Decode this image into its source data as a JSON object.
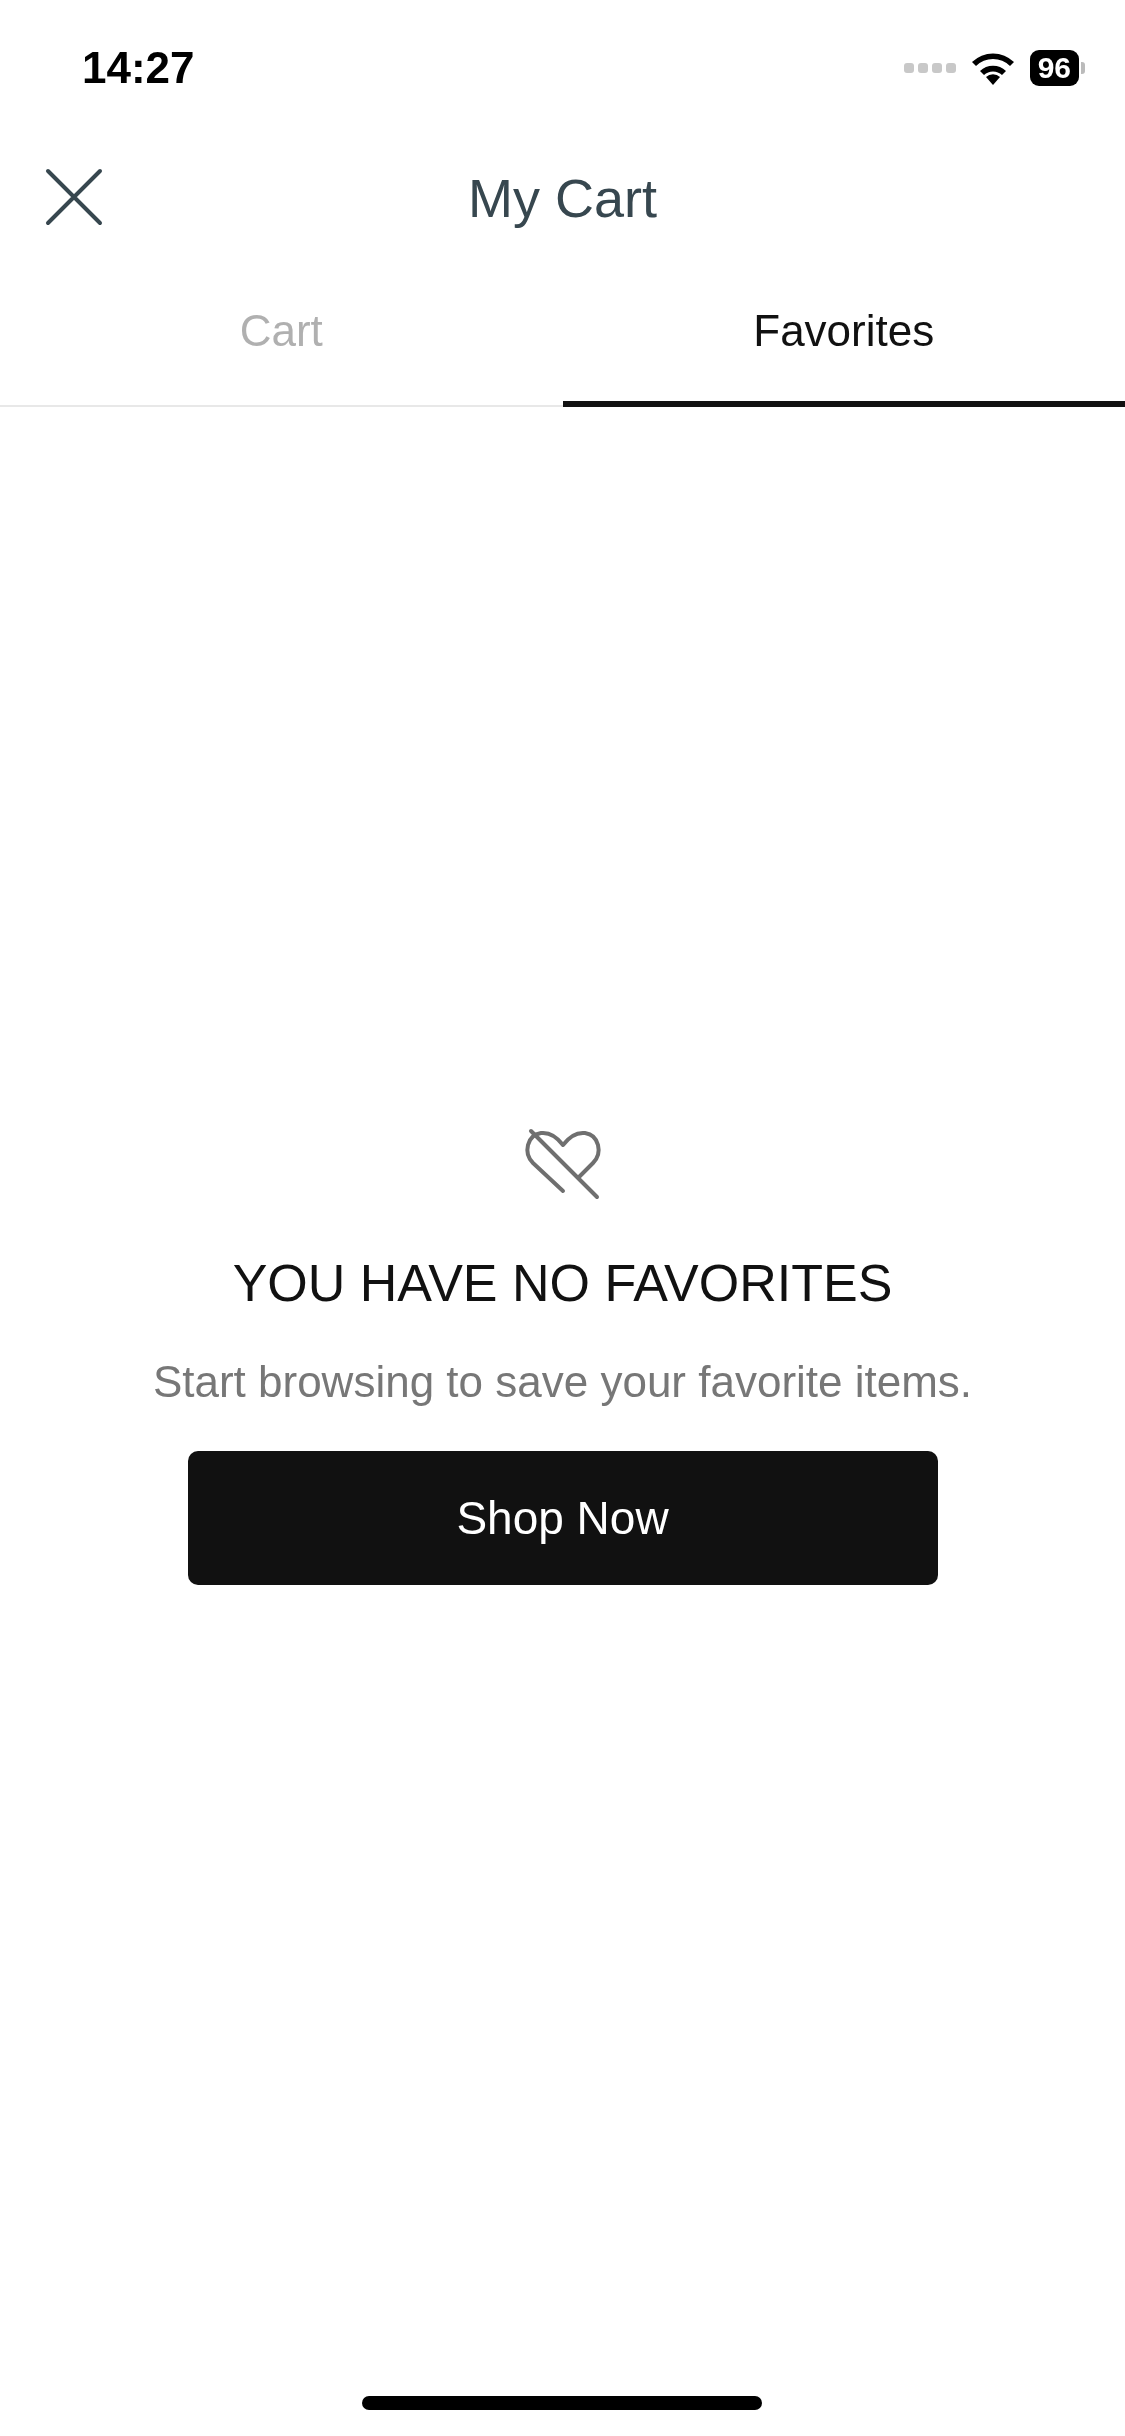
{
  "status_bar": {
    "time": "14:27",
    "battery": "96"
  },
  "header": {
    "title": "My Cart"
  },
  "tabs": [
    {
      "label": "Cart",
      "selected": false
    },
    {
      "label": "Favorites",
      "selected": true
    }
  ],
  "empty_state": {
    "heading": "YOU HAVE NO FAVORITES",
    "message": "Start browsing to save your favorite items.",
    "button": "Shop Now"
  }
}
